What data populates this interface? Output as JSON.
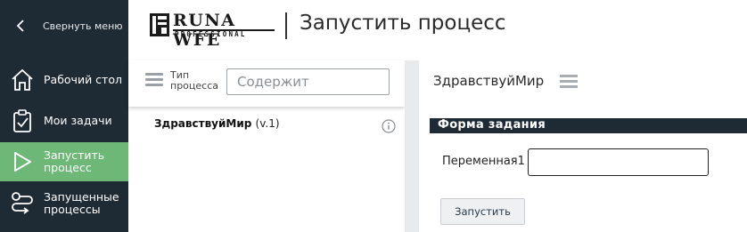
{
  "sidebar": {
    "collapse_label": "Свернуть меню",
    "items": [
      {
        "label": "Рабочий стол",
        "icon": "home-icon",
        "active": false
      },
      {
        "label": "Мои задачи",
        "icon": "clipboard-check-icon",
        "active": false
      },
      {
        "label": "Запустить\nпроцесс",
        "icon": "play-icon",
        "active": true
      },
      {
        "label": "Запущенные\nпроцессы",
        "icon": "process-flow-icon",
        "active": false
      }
    ],
    "bg_color": "#1e2a34",
    "active_color": "#6db877"
  },
  "header": {
    "logo_word": "RUNA WFE",
    "logo_sub": "PROFESSIONAL",
    "title": "Запустить процесс"
  },
  "left_panel": {
    "filter_label": "Тип\nпроцесса",
    "filter_placeholder": "Содержит",
    "process": {
      "name": "ЗдравствуйМир",
      "version": "(v.1)"
    }
  },
  "right_panel": {
    "title": "ЗдравствуйМир",
    "form_header": "Форма задания",
    "variable_label": "Переменная1",
    "variable_value": "",
    "run_button": "Запустить"
  }
}
